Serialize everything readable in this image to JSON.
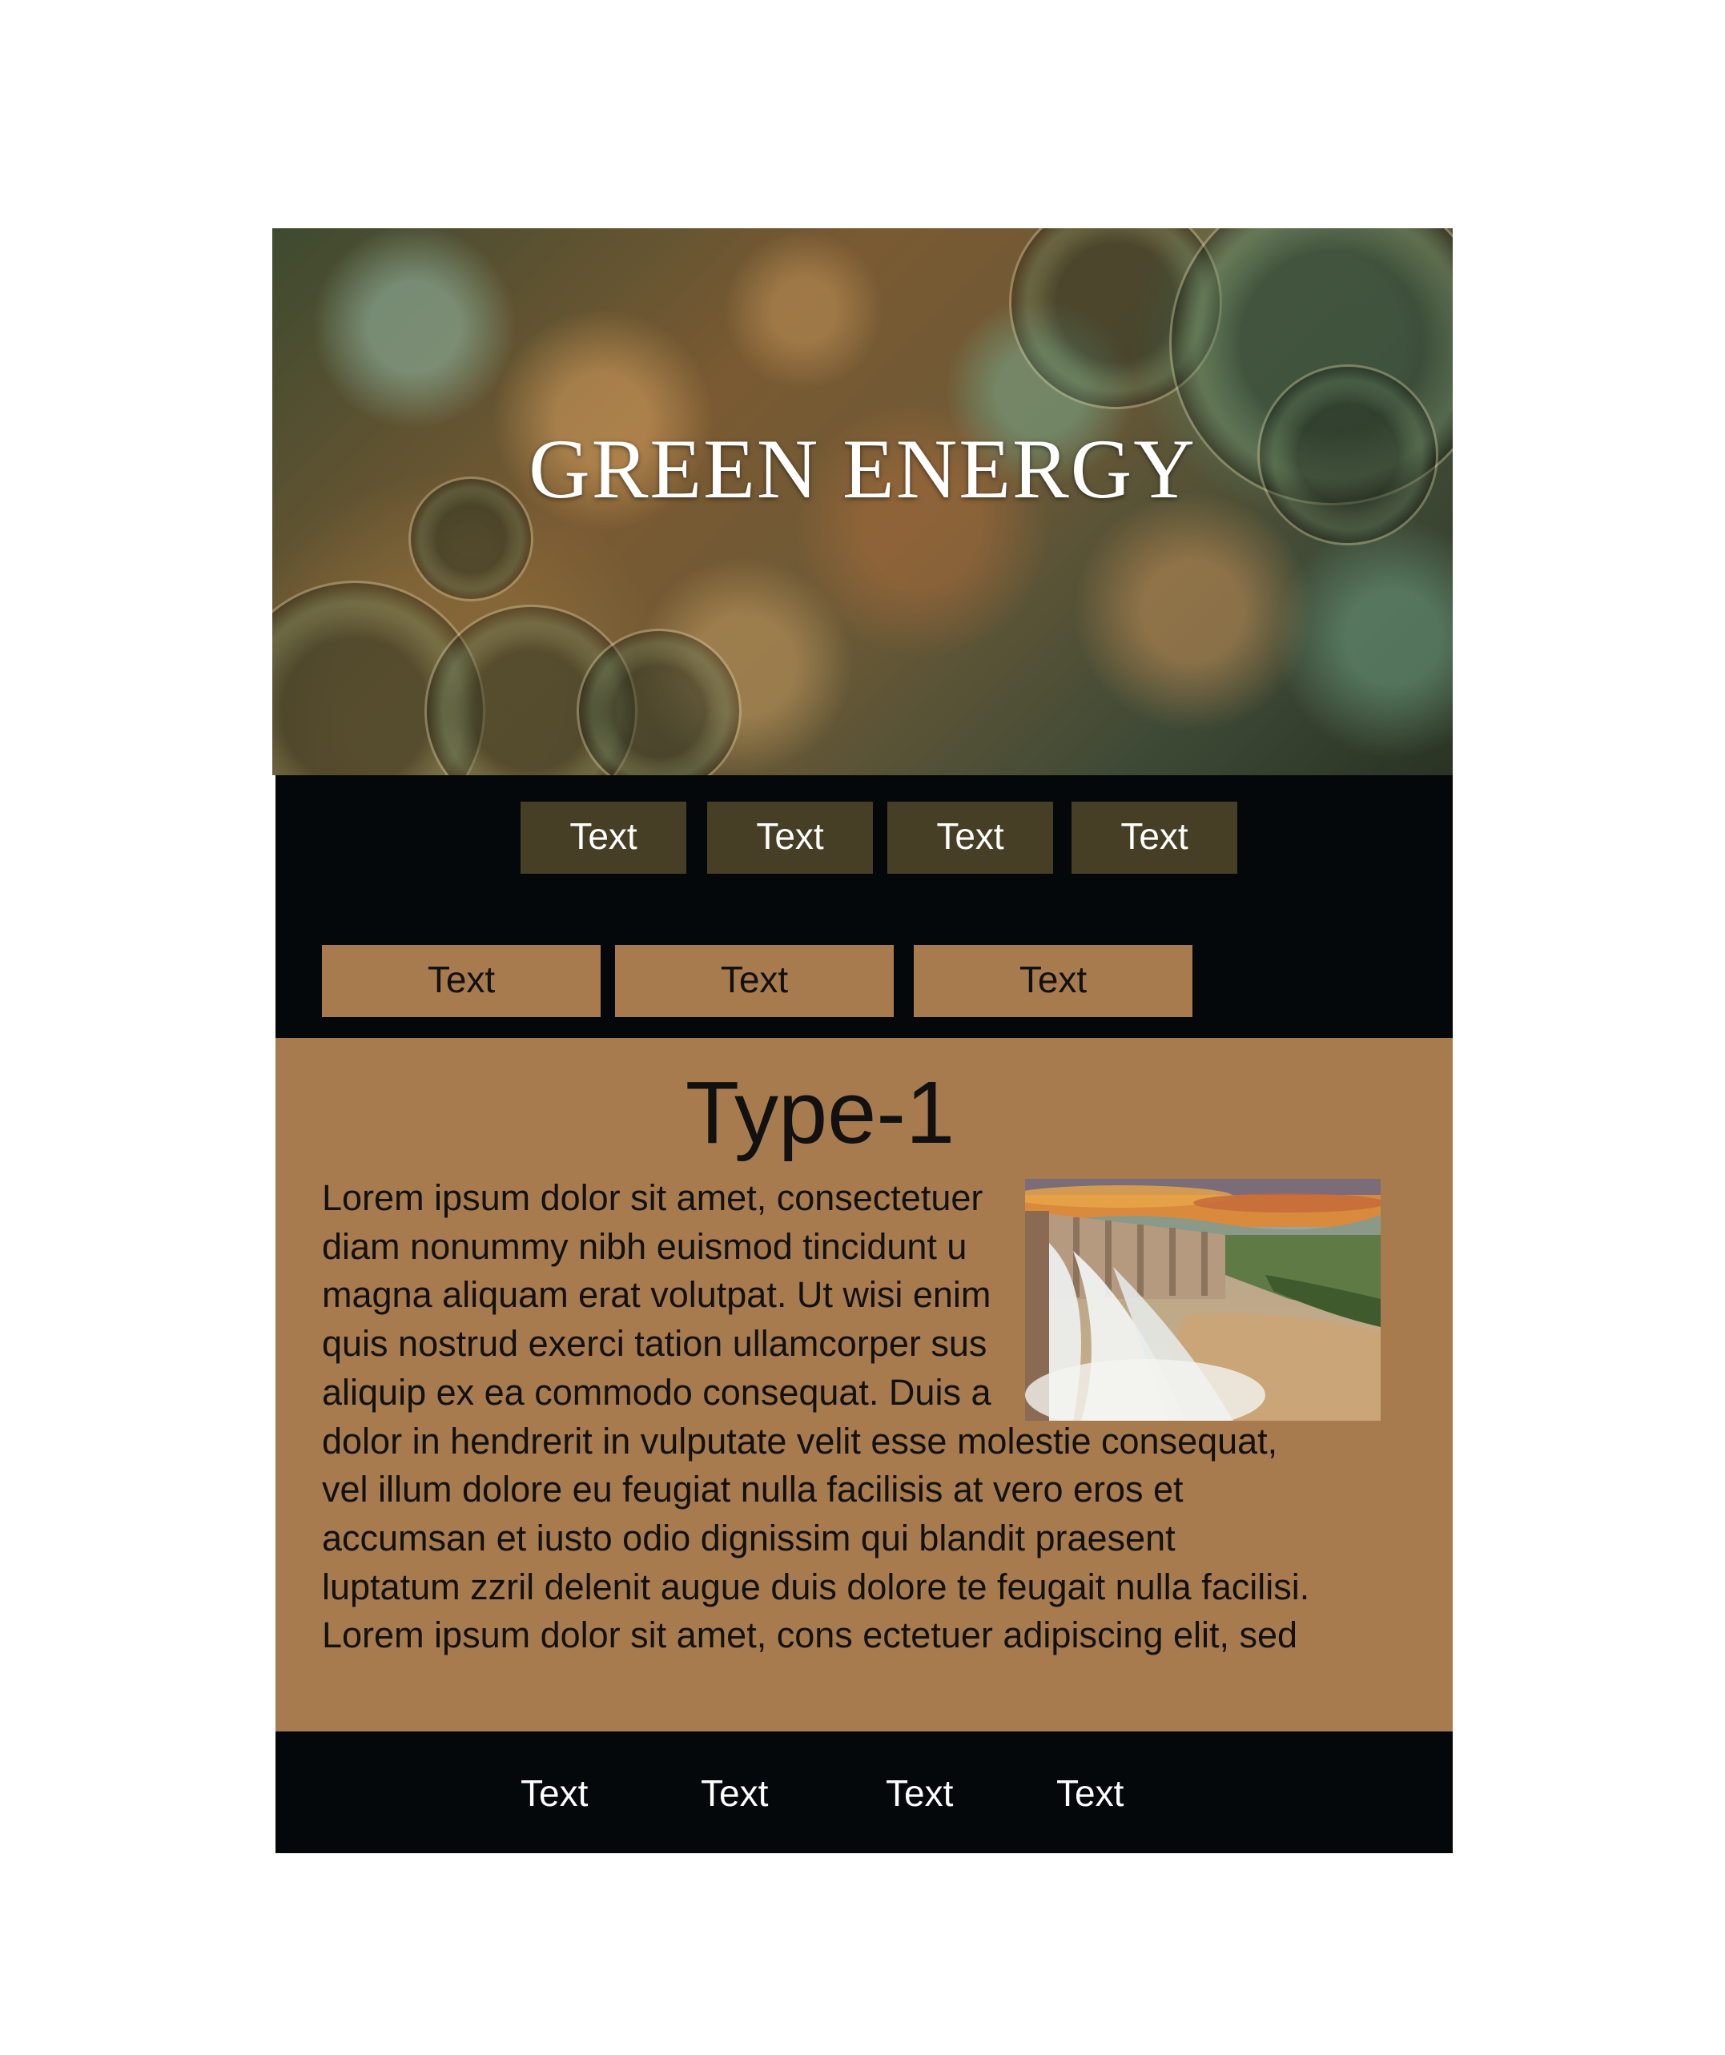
{
  "hero": {
    "title": "GREEN ENERGY"
  },
  "nav": {
    "primary_tabs": [
      {
        "label": "Text"
      },
      {
        "label": "Text"
      },
      {
        "label": "Text"
      },
      {
        "label": "Text"
      }
    ],
    "secondary_tabs": [
      {
        "label": "Text"
      },
      {
        "label": "Text"
      },
      {
        "label": "Text"
      }
    ]
  },
  "content": {
    "title": "Type-1",
    "body": "Lorem ipsum dolor sit amet, consectetuer\ndiam nonummy nibh euismod tincidunt u\nmagna aliquam erat volutpat. Ut wisi enim\nquis nostrud exerci tation ullamcorper sus\naliquip ex ea commodo consequat. Duis a\ndolor in hendrerit in vulputate velit esse molestie consequat,\nvel illum dolore eu feugiat nulla facilisis at vero eros et\naccumsan et iusto odio dignissim qui blandit praesent\nluptatum zzril delenit augue duis dolore te feugait nulla facilisi.\nLorem ipsum dolor sit amet, cons ectetuer adipiscing elit, sed",
    "image_icon": "dam-photo"
  },
  "footer": {
    "links": [
      {
        "label": "Text"
      },
      {
        "label": "Text"
      },
      {
        "label": "Text"
      },
      {
        "label": "Text"
      }
    ]
  },
  "colors": {
    "brown": "#a87b4e",
    "dark_olive": "#463f25",
    "black": "#04080a",
    "white": "#ffffff"
  }
}
